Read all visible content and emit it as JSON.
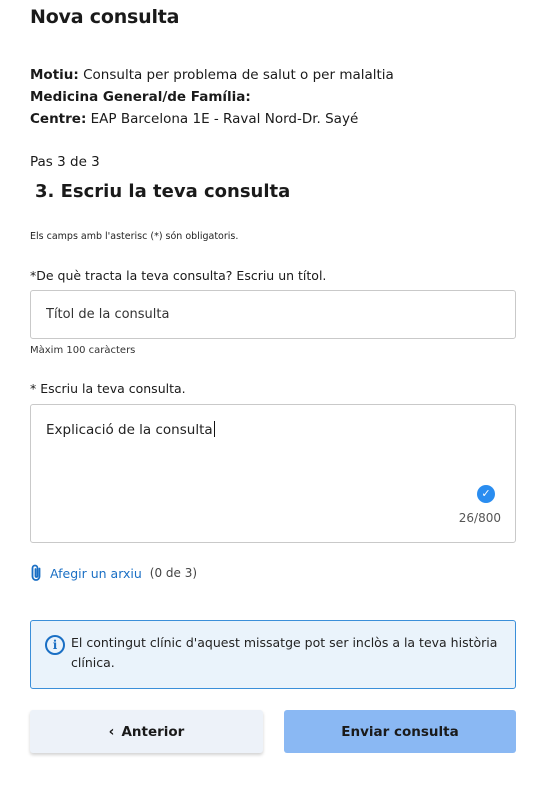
{
  "header": {
    "title": "Nova consulta"
  },
  "info": {
    "reason_label": "Motiu:",
    "reason_value": "Consulta per problema de salut o per malaltia",
    "specialty_label": "Medicina General/de Família:",
    "center_label": "Centre:",
    "center_value": "EAP Barcelona 1E - Raval Nord-Dr. Sayé"
  },
  "steps": {
    "indicator": "Pas 3 de 3",
    "title": "3. Escriu la teva consulta"
  },
  "form": {
    "required_note": "Els camps amb l'asterisc (*) són obligatoris.",
    "title_label": "*De què tracta la teva consulta? Escriu un títol.",
    "title_placeholder": "Títol de la consulta",
    "title_hint": "Màxim 100 caràcters",
    "body_label": "* Escriu la teva consulta.",
    "body_value": "Explicació de la consulta",
    "char_counter": "26/800"
  },
  "attachments": {
    "link_label": "Afegir un arxiu",
    "count": "(0 de 3)"
  },
  "notice": {
    "text": "El contingut clínic d'aquest missatge pot ser inclòs a la teva història clínica."
  },
  "buttons": {
    "previous": "Anterior",
    "send": "Enviar consulta"
  },
  "colors": {
    "accent": "#1a6fc4",
    "send_button": "#8ab8f3",
    "notice_bg": "#eaf3fb",
    "check": "#2a8df0"
  }
}
